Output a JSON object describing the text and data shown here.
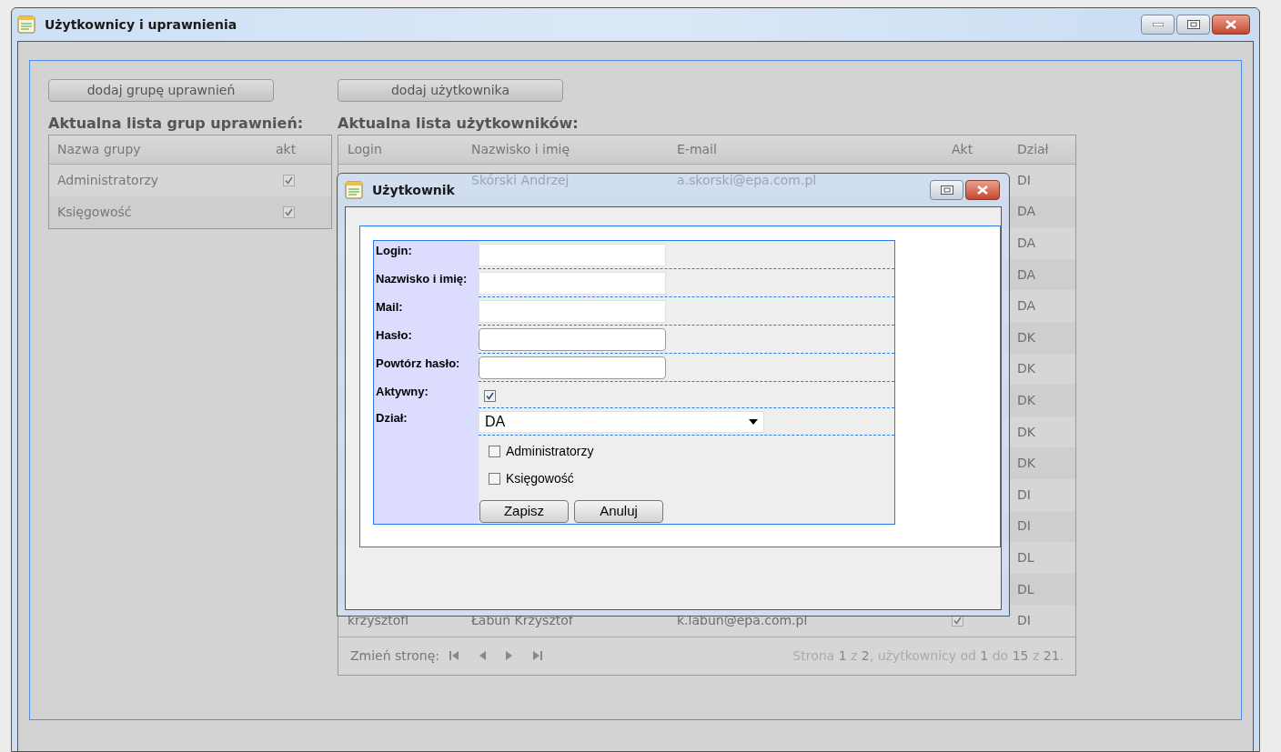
{
  "window": {
    "title": "Użytkownicy i uprawnienia"
  },
  "toolbar": {
    "add_group_button": "dodaj grupę uprawnień",
    "add_user_button": "dodaj użytkownika"
  },
  "groups_panel": {
    "heading": "Aktualna lista grup uprawnień:",
    "columns": [
      "Nazwa grupy",
      "akt"
    ],
    "rows": [
      {
        "name": "Administratorzy",
        "active": true
      },
      {
        "name": "Księgowość",
        "active": true
      }
    ]
  },
  "users_panel": {
    "heading": "Aktualna lista użytkowników:",
    "columns": [
      "Login",
      "Nazwisko i imię",
      "E-mail",
      "Akt",
      "Dział"
    ],
    "rows": [
      {
        "name": "Skórski Andrzej",
        "email": "a.skorski@epa.com.pl",
        "dept": "DI"
      },
      {
        "dept": "DA"
      },
      {
        "dept": "DA"
      },
      {
        "dept": "DA"
      },
      {
        "dept": "DA"
      },
      {
        "dept": "DK"
      },
      {
        "dept": "DK"
      },
      {
        "dept": "DK"
      },
      {
        "dept": "DK"
      },
      {
        "dept": "DK"
      },
      {
        "dept": "DI"
      },
      {
        "dept": "DI"
      },
      {
        "dept": "DL"
      },
      {
        "dept": "DL"
      },
      {
        "login": "krzysztofl",
        "name": "Łabuń Krzysztof",
        "email": "k.labun@epa.com.pl",
        "active": true,
        "dept": "DI"
      }
    ],
    "pager_label": "Zmień stronę:",
    "page_info": "Strona **1** z **2**, użytkownicy od **1** do **15** z **21**."
  },
  "dialog": {
    "title": "Użytkownik",
    "fields": [
      {
        "kind": "input",
        "label": "Login:"
      },
      {
        "kind": "input",
        "label": "Nazwisko i imię:"
      },
      {
        "kind": "input",
        "label": "Mail:"
      },
      {
        "kind": "password",
        "label": "Hasło:"
      },
      {
        "kind": "password",
        "label": "Powtórz hasło:"
      },
      {
        "kind": "checkbox",
        "label": "Aktywny:",
        "checked": true
      },
      {
        "kind": "select",
        "label": "Dział:",
        "value": "DA"
      }
    ],
    "groups": [
      {
        "label": "Administratorzy",
        "checked": false
      },
      {
        "label": "Księgowość",
        "checked": false
      }
    ],
    "buttons": [
      "Zapisz",
      "Anuluj"
    ]
  }
}
